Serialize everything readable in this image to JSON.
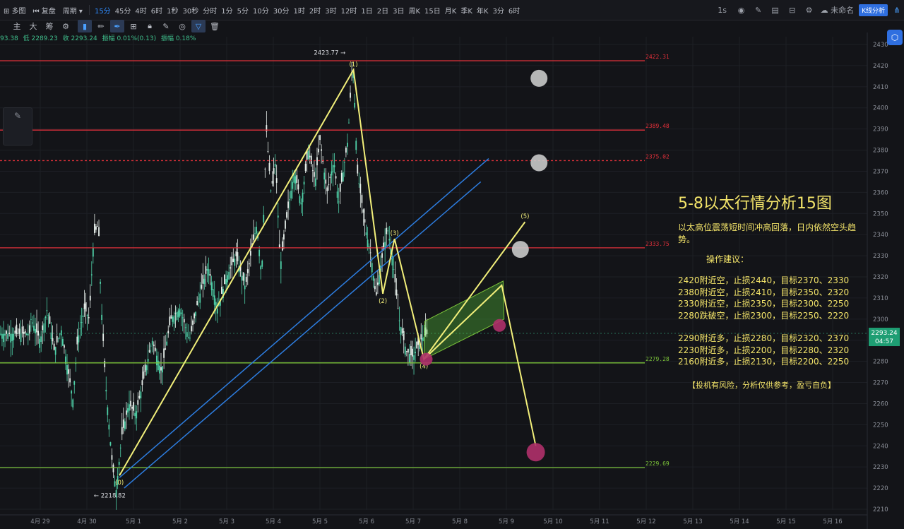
{
  "topbar": {
    "items": [
      "多图",
      "复盘",
      "周期"
    ],
    "periods": [
      "15分",
      "45分",
      "4时",
      "6时",
      "1秒",
      "30秒",
      "分时",
      "1分",
      "5分",
      "10分",
      "30分",
      "1时",
      "2时",
      "3时",
      "12时",
      "1日",
      "2日",
      "3日",
      "周K",
      "15日",
      "月K",
      "季K",
      "年K",
      "3分",
      "6时"
    ],
    "active_period": "15分",
    "interval": "1s",
    "layout_name": "未命名",
    "kline_button": "K线分析"
  },
  "toolbar": {
    "labels": [
      "主",
      "大",
      "筹"
    ]
  },
  "infoline": {
    "parts": [
      "93.38",
      "低 2289.23",
      "收 2293.24",
      "振幅 0.01%(0.13)",
      "振幅 0.18%"
    ]
  },
  "analysis": {
    "title": "5-8以太行情分析15图",
    "summary": "以太高位震荡短时间冲高回落，日内依然空头趋势。",
    "subhead": "操作建议：",
    "short_ops": [
      "2420附近空，止损2440，目标2370、2330",
      "2380附近空，止损2410，目标2350、2320",
      "2330附近空，止损2350，目标2300、2250",
      "2280跌破空，止损2300，目标2250、2220"
    ],
    "long_ops": [
      "2290附近多，止损2280，目标2320、2370",
      "2230附近多，止损2200，目标2280、2320",
      "2160附近多，止损2130，目标2200、2250"
    ],
    "warning": "【投机有风险，分析仅供参考，盈亏自负】"
  },
  "chart_data": {
    "type": "line",
    "title": "",
    "xlabel": "",
    "ylabel": "",
    "ylim": [
      2210,
      2430
    ],
    "y_ticks": [
      2210,
      2220,
      2230,
      2240,
      2250,
      2260,
      2270,
      2280,
      2290,
      2300,
      2310,
      2320,
      2330,
      2340,
      2350,
      2360,
      2370,
      2380,
      2390,
      2400,
      2410,
      2420,
      2430
    ],
    "x_ticks": [
      "4月 29",
      "4月 30",
      "5月 1",
      "5月 2",
      "5月 3",
      "5月 4",
      "5月 5",
      "5月 6",
      "5月 7",
      "5月 8",
      "5月 9",
      "5月 10",
      "5月 11",
      "5月 12",
      "5月 13",
      "5月 14",
      "5月 15",
      "5月 16"
    ],
    "horizontal_levels": [
      {
        "value": 2422.31,
        "label": "2422.31",
        "color": "#e0303a",
        "style": "solid"
      },
      {
        "value": 2389.48,
        "label": "2389.48",
        "color": "#e0303a",
        "style": "solid"
      },
      {
        "value": 2375.02,
        "label": "2375.02",
        "color": "#e0303a",
        "style": "dashed"
      },
      {
        "value": 2333.75,
        "label": "2333.75",
        "color": "#e0303a",
        "style": "solid"
      },
      {
        "value": 2279.28,
        "label": "2279.28",
        "color": "#7cc43a",
        "style": "solid"
      },
      {
        "value": 2229.69,
        "label": "2229.69",
        "color": "#7cc43a",
        "style": "solid"
      }
    ],
    "current_price": "2293.24",
    "countdown": "04:57",
    "high_label": "2423.77",
    "low_label": "2218.82",
    "price_series": [
      {
        "t": -0.2,
        "v": 2300
      },
      {
        "t": 0.0,
        "v": 2290
      },
      {
        "t": 0.15,
        "v": 2305
      },
      {
        "t": 0.3,
        "v": 2285
      },
      {
        "t": 0.45,
        "v": 2295
      },
      {
        "t": 0.6,
        "v": 2275
      },
      {
        "t": 0.7,
        "v": 2262
      },
      {
        "t": 0.8,
        "v": 2290
      },
      {
        "t": 0.95,
        "v": 2305
      },
      {
        "t": 1.05,
        "v": 2300
      },
      {
        "t": 1.15,
        "v": 2340
      },
      {
        "t": 1.25,
        "v": 2345
      },
      {
        "t": 1.3,
        "v": 2310
      },
      {
        "t": 1.4,
        "v": 2270
      },
      {
        "t": 1.55,
        "v": 2230
      },
      {
        "t": 1.63,
        "v": 2219
      },
      {
        "t": 1.75,
        "v": 2245
      },
      {
        "t": 1.9,
        "v": 2260
      },
      {
        "t": 2.05,
        "v": 2255
      },
      {
        "t": 2.2,
        "v": 2270
      },
      {
        "t": 2.4,
        "v": 2290
      },
      {
        "t": 2.6,
        "v": 2275
      },
      {
        "t": 2.8,
        "v": 2300
      },
      {
        "t": 3.0,
        "v": 2305
      },
      {
        "t": 3.2,
        "v": 2290
      },
      {
        "t": 3.4,
        "v": 2310
      },
      {
        "t": 3.6,
        "v": 2325
      },
      {
        "t": 3.8,
        "v": 2305
      },
      {
        "t": 4.0,
        "v": 2320
      },
      {
        "t": 4.2,
        "v": 2330
      },
      {
        "t": 4.4,
        "v": 2315
      },
      {
        "t": 4.55,
        "v": 2335
      },
      {
        "t": 4.65,
        "v": 2345
      },
      {
        "t": 4.75,
        "v": 2320
      },
      {
        "t": 4.85,
        "v": 2390
      },
      {
        "t": 4.95,
        "v": 2360
      },
      {
        "t": 5.05,
        "v": 2375
      },
      {
        "t": 5.15,
        "v": 2325
      },
      {
        "t": 5.3,
        "v": 2350
      },
      {
        "t": 5.45,
        "v": 2370
      },
      {
        "t": 5.6,
        "v": 2355
      },
      {
        "t": 5.75,
        "v": 2380
      },
      {
        "t": 5.9,
        "v": 2365
      },
      {
        "t": 6.0,
        "v": 2385
      },
      {
        "t": 6.15,
        "v": 2360
      },
      {
        "t": 6.3,
        "v": 2375
      },
      {
        "t": 6.4,
        "v": 2355
      },
      {
        "t": 6.5,
        "v": 2370
      },
      {
        "t": 6.6,
        "v": 2385
      },
      {
        "t": 6.7,
        "v": 2423
      },
      {
        "t": 6.75,
        "v": 2400
      },
      {
        "t": 6.8,
        "v": 2370
      },
      {
        "t": 6.9,
        "v": 2355
      },
      {
        "t": 7.0,
        "v": 2340
      },
      {
        "t": 7.1,
        "v": 2330
      },
      {
        "t": 7.2,
        "v": 2310
      },
      {
        "t": 7.3,
        "v": 2325
      },
      {
        "t": 7.45,
        "v": 2343
      },
      {
        "t": 7.55,
        "v": 2330
      },
      {
        "t": 7.7,
        "v": 2300
      },
      {
        "t": 7.85,
        "v": 2285
      },
      {
        "t": 8.0,
        "v": 2282
      },
      {
        "t": 8.15,
        "v": 2290
      },
      {
        "t": 8.3,
        "v": 2293
      }
    ],
    "projection": [
      {
        "t": 1.7,
        "v": 2226,
        "label": "(0)"
      },
      {
        "t": 6.72,
        "v": 2418,
        "label": "(1)"
      },
      {
        "t": 7.35,
        "v": 2312,
        "label": "(2)"
      },
      {
        "t": 7.6,
        "v": 2338,
        "label": "(3)"
      },
      {
        "t": 8.23,
        "v": 2281,
        "label": "(4)"
      },
      {
        "t": 10.4,
        "v": 2346,
        "label": "(5)"
      }
    ],
    "bear_path": [
      {
        "t": 8.23,
        "v": 2281
      },
      {
        "t": 9.9,
        "v": 2316
      },
      {
        "t": 10.63,
        "v": 2240
      }
    ],
    "channel": [
      {
        "from": {
          "t": 1.7,
          "v": 2225
        },
        "to": {
          "t": 9.62,
          "v": 2376
        }
      },
      {
        "from": {
          "t": 1.8,
          "v": 2220
        },
        "to": {
          "t": 9.45,
          "v": 2365
        }
      }
    ],
    "triangle": [
      {
        "t": 8.23,
        "v": 2281
      },
      {
        "t": 8.25,
        "v": 2299
      },
      {
        "t": 9.93,
        "v": 2318
      },
      {
        "t": 9.95,
        "v": 2300
      }
    ],
    "markers": [
      {
        "t": 10.7,
        "v": 2414,
        "color": "#c9c9c9"
      },
      {
        "t": 10.7,
        "v": 2374,
        "color": "#c9c9c9"
      },
      {
        "t": 10.3,
        "v": 2333,
        "color": "#c9c9c9"
      },
      {
        "t": 9.85,
        "v": 2297,
        "color": "#b0306a"
      },
      {
        "t": 8.28,
        "v": 2281,
        "color": "#b0306a"
      },
      {
        "t": 10.63,
        "v": 2237,
        "color": "#b0306a"
      }
    ]
  }
}
